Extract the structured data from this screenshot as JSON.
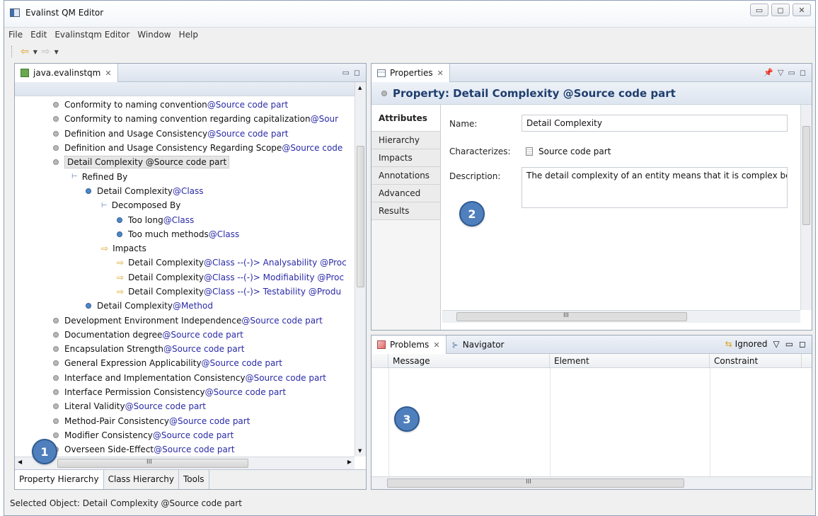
{
  "window": {
    "title": "Evalinst QM Editor",
    "controls": [
      "▭",
      "◻",
      "✕"
    ]
  },
  "menu": [
    "File",
    "Edit",
    "Evalinstqm Editor",
    "Window",
    "Help"
  ],
  "left_panel": {
    "tab": "java.evalinstqm",
    "items": [
      {
        "label": "Conformity to naming convention ",
        "ctx": "@Source code part"
      },
      {
        "label": "Conformity to naming convention regarding capitalization ",
        "ctx": "@Sour"
      },
      {
        "label": "Definition and Usage Consistency ",
        "ctx": "@Source code part"
      },
      {
        "label": "Definition and Usage Consistency Regarding Scope ",
        "ctx": "@Source code"
      },
      {
        "label": "Detail Complexity @Source code part",
        "ctx": ""
      },
      {
        "label": "Refined By",
        "ctx": ""
      },
      {
        "label": "Detail Complexity ",
        "ctx": "@Class"
      },
      {
        "label": "Decomposed By",
        "ctx": ""
      },
      {
        "label": "Too long ",
        "ctx": "@Class"
      },
      {
        "label": "Too much methods ",
        "ctx": "@Class"
      },
      {
        "label": "Impacts",
        "ctx": ""
      },
      {
        "label": "Detail Complexity ",
        "ctx": "@Class --(-)> Analysability @Proc"
      },
      {
        "label": "Detail Complexity ",
        "ctx": "@Class --(-)> Modifiability @Proc"
      },
      {
        "label": "Detail Complexity ",
        "ctx": "@Class --(-)> Testability @Produ"
      },
      {
        "label": "Detail Complexity ",
        "ctx": "@Method"
      },
      {
        "label": "Development Environment Independence ",
        "ctx": "@Source code part"
      },
      {
        "label": "Documentation degree ",
        "ctx": "@Source code part"
      },
      {
        "label": "Encapsulation Strength ",
        "ctx": "@Source code part"
      },
      {
        "label": "General Expression Applicability ",
        "ctx": "@Source code part"
      },
      {
        "label": "Interface and Implementation Consistency ",
        "ctx": "@Source code part"
      },
      {
        "label": "Interface Permission Consistency ",
        "ctx": "@Source code part"
      },
      {
        "label": "Literal Validity ",
        "ctx": "@Source code part"
      },
      {
        "label": "Method-Pair Consistency  ",
        "ctx": "@Source code part"
      },
      {
        "label": "Modifier Consistency ",
        "ctx": "@Source code part"
      },
      {
        "label": "Overseen Side-Effect ",
        "ctx": "@Source code part"
      }
    ],
    "bottom_tabs": [
      "Property Hierarchy",
      "Class Hierarchy",
      "Tools"
    ],
    "scroll_mark": "III"
  },
  "properties": {
    "tab": "Properties",
    "heading": "Property: Detail Complexity @Source code part",
    "vtabs": [
      "Attributes",
      "Hierarchy",
      "Impacts",
      "Annotations",
      "Advanced",
      "Results"
    ],
    "name_label": "Name:",
    "name_value": "Detail Complexity",
    "characterizes_label": "Characterizes:",
    "characterizes_value": "Source code part",
    "description_label": "Description:",
    "description_value": "The detail complexity of an entity means that it is complex becau",
    "scroll_mark": "III"
  },
  "problems": {
    "tab": "Problems",
    "tab2": "Navigator",
    "filter": "Ignored",
    "columns": [
      "Message",
      "Element",
      "Constraint"
    ],
    "scroll_mark": "III"
  },
  "badges": [
    "1",
    "2",
    "3"
  ],
  "status_bar": "Selected Object: Detail Complexity @Source code part"
}
